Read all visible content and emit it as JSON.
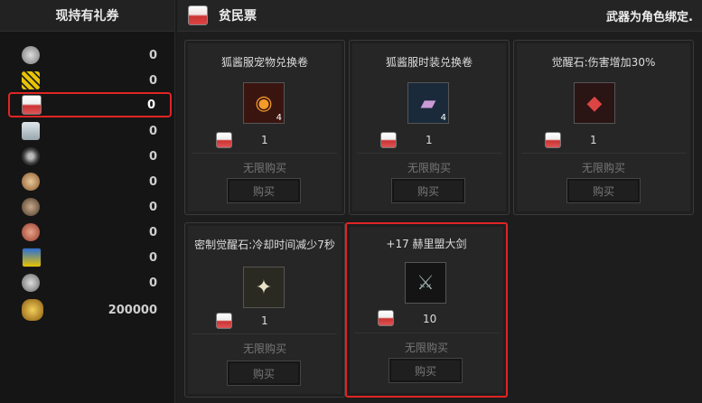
{
  "left_panel": {
    "header": "现持有礼券",
    "coupons": [
      {
        "icon": "silver-coin-icon",
        "count": "0"
      },
      {
        "icon": "gold-ticket-icon",
        "count": "0"
      },
      {
        "icon": "poor-ticket-icon",
        "count": "0"
      },
      {
        "icon": "paper-ticket-icon",
        "count": "0"
      },
      {
        "icon": "bomb-coin-icon",
        "count": "0"
      },
      {
        "icon": "bronze-medal-icon",
        "count": "0"
      },
      {
        "icon": "dark-medal-icon",
        "count": "0"
      },
      {
        "icon": "copper-coin-icon",
        "count": "0"
      },
      {
        "icon": "blue-card-icon",
        "count": "0"
      },
      {
        "icon": "grey-coin-icon",
        "count": "0"
      },
      {
        "icon": "gold-pouch-icon",
        "count": "200000"
      }
    ]
  },
  "header": {
    "title": "贫民票",
    "note": "武器为角色绑定."
  },
  "cards": [
    {
      "name": "狐酱服宠物兑换卷",
      "item_icon": "cat-coupon-icon",
      "qty": "4",
      "cost": "1",
      "limit": "无限购买",
      "buy": "购买"
    },
    {
      "name": "狐酱服时装兑换卷",
      "item_icon": "card-coupon-icon",
      "qty": "4",
      "cost": "1",
      "limit": "无限购买",
      "buy": "购买"
    },
    {
      "name": "觉醒石:伤害增加30%",
      "item_icon": "awakening-stone-icon",
      "qty": "",
      "cost": "1",
      "limit": "无限购买",
      "buy": "购买"
    },
    {
      "name": "密制觉醒石:冷却时间减少7秒",
      "item_icon": "secret-stone-icon",
      "qty": "",
      "cost": "1",
      "limit": "无限购买",
      "buy": "购买"
    },
    {
      "name": "+17 赫里盟大剑",
      "item_icon": "greatsword-icon",
      "qty": "",
      "cost": "10",
      "limit": "无限购买",
      "buy": "购买"
    }
  ]
}
